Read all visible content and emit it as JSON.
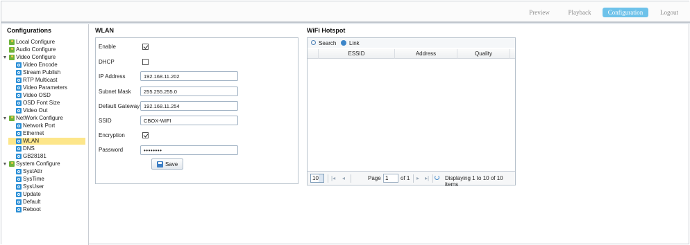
{
  "nav": {
    "preview": "Preview",
    "playback": "Playback",
    "configuration": "Configuration",
    "logout": "Logout"
  },
  "sidebar": {
    "title": "Configurations",
    "groups": [
      {
        "label": "Local Configure"
      },
      {
        "label": "Audio Configure"
      },
      {
        "label": "Video Configure",
        "items": [
          "Video Encode",
          "Stream Publish",
          "RTP Multicast",
          "Video Parameters",
          "Video OSD",
          "OSD Font Size",
          "Video Out"
        ]
      },
      {
        "label": "NetWork Configure",
        "items": [
          "Network Port",
          "Ethernet",
          "WLAN",
          "DNS",
          "GB28181"
        ]
      },
      {
        "label": "System Configure",
        "items": [
          "SystAttr",
          "SysTime",
          "SysUser",
          "Update",
          "Default",
          "Reboot"
        ]
      }
    ],
    "selected": "WLAN"
  },
  "wlan": {
    "title": "WLAN",
    "enable_label": "Enable",
    "enable_checked": true,
    "dhcp_label": "DHCP",
    "dhcp_checked": false,
    "ip_label": "IP Address",
    "ip_value": "192.168.11.202",
    "mask_label": "Subnet Mask",
    "mask_value": "255.255.255.0",
    "gateway_label": "Default Gateway",
    "gateway_value": "192.168.11.254",
    "ssid_label": "SSID",
    "ssid_value": "CBOX-WIFI",
    "encryption_label": "Encryption",
    "encryption_checked": true,
    "password_label": "Password",
    "password_value": "12345678",
    "save_label": "Save"
  },
  "hotspot": {
    "title": "WiFi Hotspot",
    "search_label": "Search",
    "link_label": "Link",
    "columns": [
      "ESSID",
      "Address",
      "Quality"
    ],
    "rows": [],
    "pager": {
      "page_size": "10",
      "page_label": "Page",
      "page_value": "1",
      "of_label": "of 1",
      "display_text": "Displaying 1 to 10 of 10 items"
    }
  },
  "colors": {
    "active_tab": "#6ec2ea",
    "selected_row": "#fde68a",
    "tree_icon_green": "#6fb33b",
    "tree_icon_blue": "#2b8fd6"
  }
}
